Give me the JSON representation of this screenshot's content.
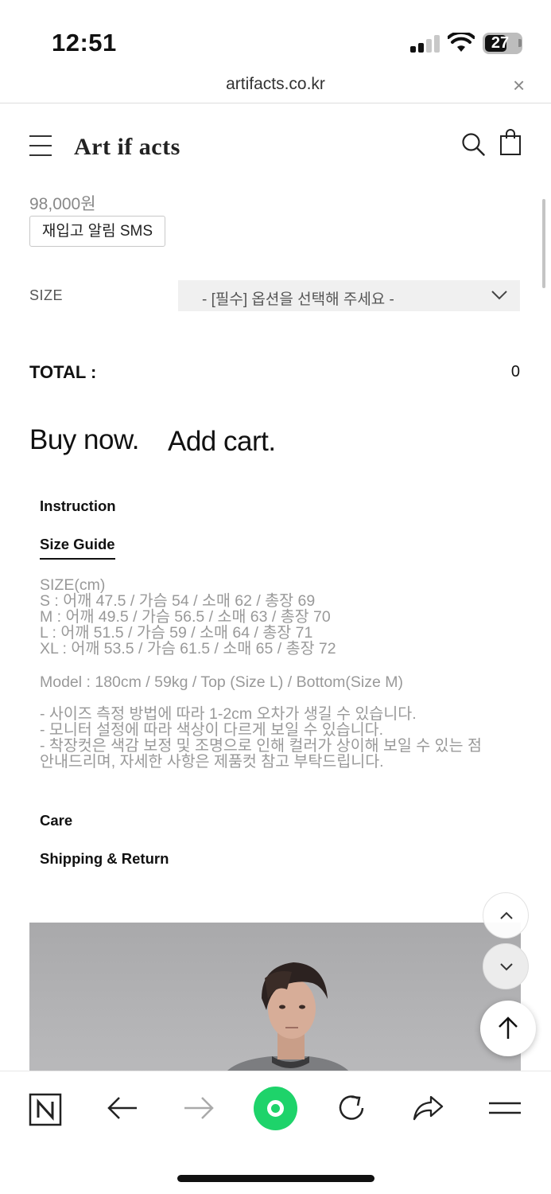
{
  "status_bar": {
    "time": "12:51",
    "battery_level": "27",
    "icons": [
      "cellular-signal-icon",
      "wifi-icon",
      "battery-icon"
    ]
  },
  "browser": {
    "url": "artifacts.co.kr",
    "close_icon": "close-icon"
  },
  "header": {
    "logo": "Art if acts",
    "icons": [
      "hamburger-menu-icon",
      "search-icon",
      "shopping-bag-icon"
    ]
  },
  "product": {
    "price": "98,000원",
    "restock_button": "재입고 알림 SMS",
    "size_label": "SIZE",
    "size_select_value": "- [필수] 옵션을 선택해 주세요 -",
    "total_label": "TOTAL :",
    "total_value": "0",
    "buy_now": "Buy now.",
    "add_cart": "Add cart."
  },
  "tabs": {
    "instruction": "Instruction",
    "size_guide": "Size Guide",
    "care": "Care",
    "shipping": "Shipping & Return"
  },
  "size_guide": {
    "lines": [
      "SIZE(cm)",
      "S : 어깨 47.5 / 가슴 54 / 소매 62 / 총장 69",
      "M : 어깨 49.5 / 가슴 56.5 / 소매 63 / 총장 70",
      "L : 어깨 51.5 / 가슴 59 / 소매 64 / 총장 71",
      "XL : 어깨 53.5 / 가슴 61.5 / 소매 65 / 총장 72"
    ],
    "model": "Model : 180cm / 59kg / Top (Size L) / Bottom(Size M)",
    "notes": [
      "- 사이즈 측정 방법에 따라 1-2cm 오차가 생길 수 있습니다.",
      "- 모니터 설정에 따라 색상이 다르게 보일 수 있습니다.",
      "- 착장컷은 색감 보정 및 조명으로 인해 컬러가 상이해 보일 수 있는 점",
      "안내드리며, 자세한 사항은 제품컷 참고 부탁드립니다."
    ]
  },
  "floating_buttons": [
    "chevron-up-icon",
    "chevron-down-icon",
    "arrow-up-icon"
  ],
  "toolbar": {
    "icons": [
      "naver-n-icon",
      "back-arrow-icon",
      "forward-arrow-icon",
      "green-dot-icon",
      "reload-icon",
      "share-icon",
      "menu-icon"
    ]
  },
  "colors": {
    "accent_green": "#1ed36a",
    "muted_text": "#999999",
    "select_bg": "#f0f0f0"
  }
}
